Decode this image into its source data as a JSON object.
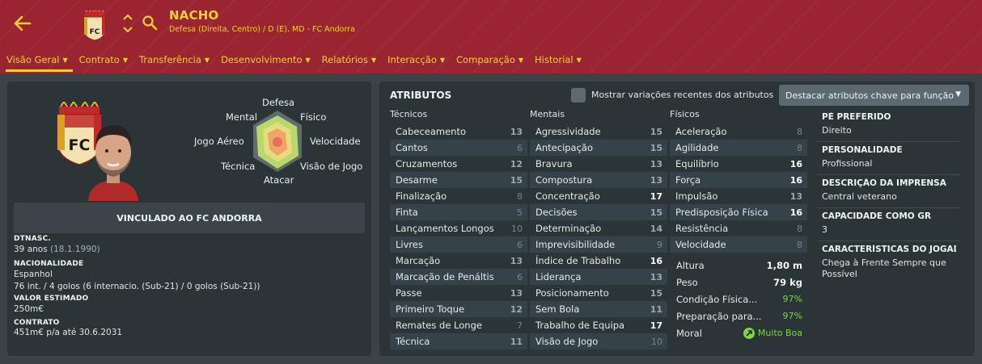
{
  "header": {
    "name": "NACHO",
    "subtitle": "Defesa (Direita, Centro) / D (E), MD - FC Andorra"
  },
  "nav": [
    {
      "label": "Visão Geral"
    },
    {
      "label": "Contrato"
    },
    {
      "label": "Transferência"
    },
    {
      "label": "Desenvolvimento"
    },
    {
      "label": "Relatórios"
    },
    {
      "label": "Interacção"
    },
    {
      "label": "Comparação"
    },
    {
      "label": "Historial"
    }
  ],
  "radar": {
    "defesa": "Defesa",
    "fisico": "Físico",
    "velocidade": "Velocidade",
    "visao": "Visão de Jogo",
    "atacar": "Atacar",
    "tecnica": "Técnica",
    "aereo": "Jogo Aéreo",
    "mental": "Mental"
  },
  "contract_banner": "VINCULADO AO FC ANDORRA",
  "info": {
    "dob_label": "DTNASC.",
    "dob_age": "39 anos",
    "dob_date": "(18.1.1990)",
    "nat_label": "NACIONALIDADE",
    "nat_value": "Espanhol",
    "nat_caps": "76 int. / 4 golos (6 internacio. (Sub-21) / 0 golos (Sub-21))",
    "value_label": "VALOR ESTIMADO",
    "value_value": "250m€",
    "contract_label": "CONTRATO",
    "contract_value": "451m€ p/a até 30.6.2031"
  },
  "attributes": {
    "title": "ATRIBUTOS",
    "toggle_label": "Mostrar variações recentes dos atributos",
    "highlight_btn": "Destacar atributos chave para função",
    "tecnicos_header": "Técnicos",
    "mentais_header": "Mentais",
    "fisicos_header": "Físicos",
    "tecnicos": [
      {
        "name": "Cabeceamento",
        "value": "13"
      },
      {
        "name": "Cantos",
        "value": "6"
      },
      {
        "name": "Cruzamentos",
        "value": "12"
      },
      {
        "name": "Desarme",
        "value": "15"
      },
      {
        "name": "Finalização",
        "value": "8"
      },
      {
        "name": "Finta",
        "value": "5"
      },
      {
        "name": "Lançamentos Longos",
        "value": "10"
      },
      {
        "name": "Livres",
        "value": "6"
      },
      {
        "name": "Marcação",
        "value": "13"
      },
      {
        "name": "Marcação de Penáltis",
        "value": "6"
      },
      {
        "name": "Passe",
        "value": "13"
      },
      {
        "name": "Primeiro Toque",
        "value": "12"
      },
      {
        "name": "Remates de Longe",
        "value": "7"
      },
      {
        "name": "Técnica",
        "value": "11"
      }
    ],
    "mentais": [
      {
        "name": "Agressividade",
        "value": "15"
      },
      {
        "name": "Antecipação",
        "value": "15"
      },
      {
        "name": "Bravura",
        "value": "13"
      },
      {
        "name": "Compostura",
        "value": "13"
      },
      {
        "name": "Concentração",
        "value": "17"
      },
      {
        "name": "Decisões",
        "value": "15"
      },
      {
        "name": "Determinação",
        "value": "14"
      },
      {
        "name": "Imprevisibilidade",
        "value": "9"
      },
      {
        "name": "Índice de Trabalho",
        "value": "16"
      },
      {
        "name": "Liderança",
        "value": "13"
      },
      {
        "name": "Posicionamento",
        "value": "15"
      },
      {
        "name": "Sem Bola",
        "value": "11"
      },
      {
        "name": "Trabalho de Equipa",
        "value": "17"
      },
      {
        "name": "Visão de Jogo",
        "value": "10"
      }
    ],
    "fisicos": [
      {
        "name": "Aceleração",
        "value": "8"
      },
      {
        "name": "Agilidade",
        "value": "8"
      },
      {
        "name": "Equilíbrio",
        "value": "16"
      },
      {
        "name": "Força",
        "value": "16"
      },
      {
        "name": "Impulsão",
        "value": "13"
      },
      {
        "name": "Predisposição Física",
        "value": "16"
      },
      {
        "name": "Resistência",
        "value": "8"
      },
      {
        "name": "Velocidade",
        "value": "8"
      }
    ],
    "extra": {
      "altura_label": "Altura",
      "altura_value": "1,80 m",
      "peso_label": "Peso",
      "peso_value": "79 kg",
      "condicao_label": "Condição Física...",
      "condicao_value": "97%",
      "preparacao_label": "Preparação para...",
      "preparacao_value": "97%",
      "moral_label": "Moral",
      "moral_value": "Muito Boa"
    }
  },
  "side_info": {
    "pe_label": "PÉ PREFERIDO",
    "pe_value": "Direito",
    "pers_label": "PERSONALIDADE",
    "pers_value": "Profissional",
    "imprensa_label": "DESCRIÇÃO DA IMPRENSA",
    "imprensa_value": "Central veterano",
    "gr_label": "CAPACIDADE COMO GR",
    "gr_value": "3",
    "carac_label": "CARACTERÍSTICAS DO JOGAD...",
    "carac_value": "Chega à Frente Sempre que Possível"
  },
  "colors": {
    "header_bg": "#9b2431",
    "accent": "#f2cf3a",
    "panel_bg": "#2b3538",
    "good": "#7fd24a"
  }
}
